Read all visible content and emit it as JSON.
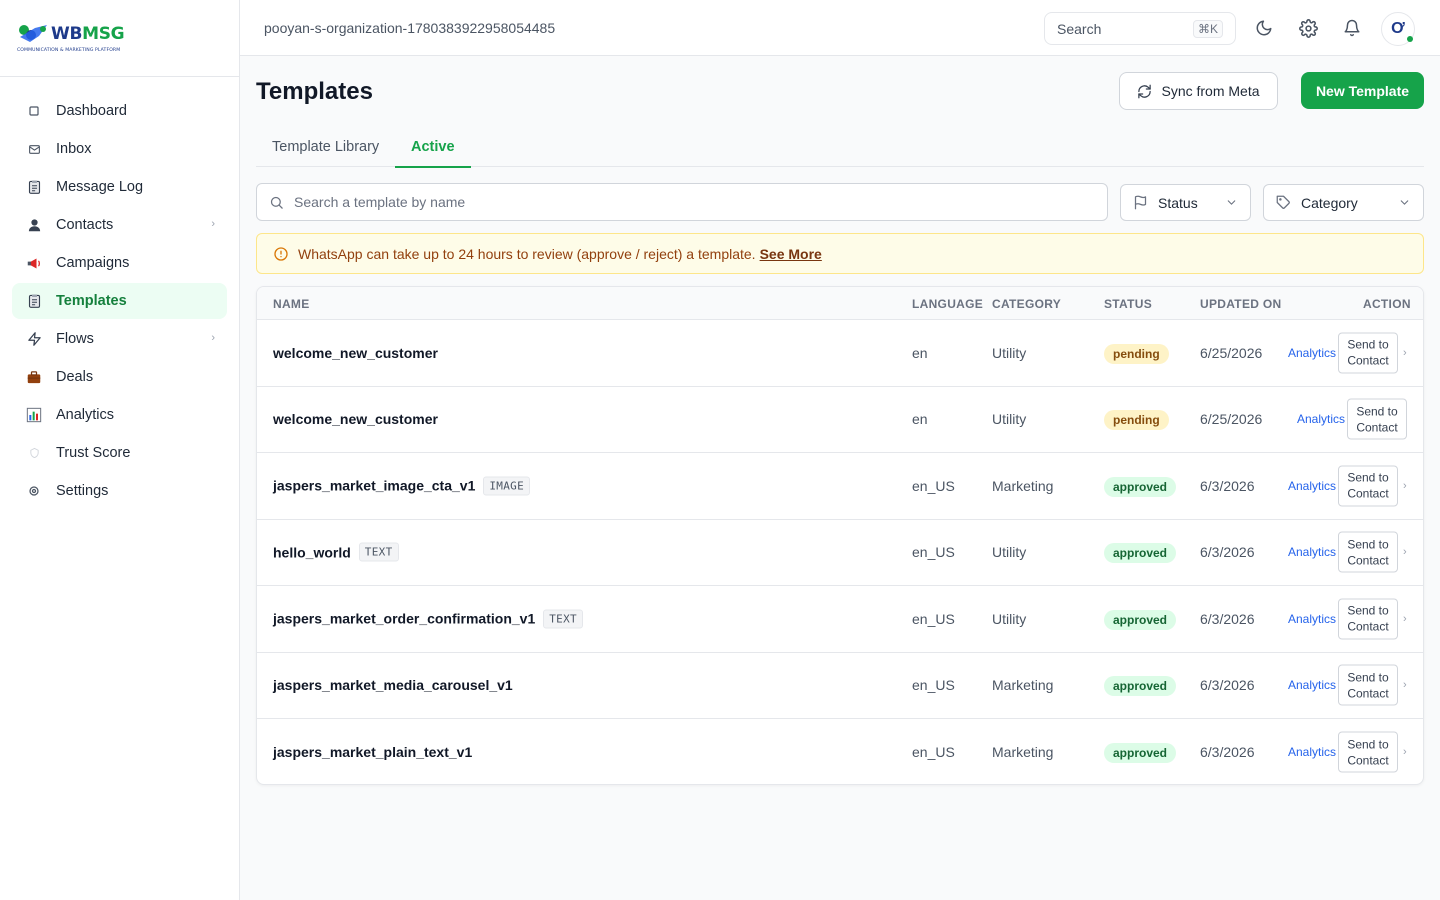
{
  "brand": {
    "name_part1": "WB",
    "name_part2": "MSG",
    "tagline": "COMMUNICATION & MARKETING PLATFORM",
    "primary_color": "#16a34a",
    "secondary_color": "#1e3a8a"
  },
  "sidebar": {
    "items": [
      {
        "label": "Dashboard",
        "icon": "square-icon",
        "active": false,
        "chevron": false
      },
      {
        "label": "Inbox",
        "icon": "envelope-icon",
        "active": false,
        "chevron": false
      },
      {
        "label": "Message Log",
        "icon": "clipboard-icon",
        "active": false,
        "chevron": false
      },
      {
        "label": "Contacts",
        "icon": "person-icon",
        "active": false,
        "chevron": true
      },
      {
        "label": "Campaigns",
        "icon": "megaphone-icon",
        "active": false,
        "chevron": false
      },
      {
        "label": "Templates",
        "icon": "clipboard-icon",
        "active": true,
        "chevron": false
      },
      {
        "label": "Flows",
        "icon": "lightning-icon",
        "active": false,
        "chevron": true
      },
      {
        "label": "Deals",
        "icon": "briefcase-icon",
        "active": false,
        "chevron": false
      },
      {
        "label": "Analytics",
        "icon": "bar-chart-icon",
        "active": false,
        "chevron": false
      },
      {
        "label": "Trust Score",
        "icon": "shield-icon",
        "active": false,
        "chevron": false
      },
      {
        "label": "Settings",
        "icon": "gear-icon",
        "active": false,
        "chevron": false
      }
    ]
  },
  "header": {
    "organization": "pooyan-s-organization-1780383922958054485",
    "search_placeholder": "Search",
    "search_shortcut": "⌘K",
    "avatar_initial": "Ơ"
  },
  "page": {
    "title": "Templates",
    "sync_button": "Sync from Meta",
    "new_button": "New Template",
    "tabs": [
      {
        "label": "Template Library",
        "active": false
      },
      {
        "label": "Active",
        "active": true
      }
    ],
    "search_placeholder": "Search a template by name",
    "status_filter": "Status",
    "category_filter": "Category",
    "notice": {
      "text": "WhatsApp can take up to 24 hours to review (approve / reject) a template.",
      "link": "See More"
    }
  },
  "table": {
    "columns": [
      "NAME",
      "LANGUAGE",
      "CATEGORY",
      "STATUS",
      "UPDATED ON",
      "ACTION"
    ],
    "analytics_label": "Analytics",
    "send_line1": "Send to",
    "send_line2": "Contact",
    "rows": [
      {
        "name": "welcome_new_customer",
        "tag": "",
        "language": "en",
        "category": "Utility",
        "status": "pending",
        "updated": "6/25/2026",
        "chevron": true
      },
      {
        "name": "welcome_new_customer",
        "tag": "",
        "language": "en",
        "category": "Utility",
        "status": "pending",
        "updated": "6/25/2026",
        "chevron": false
      },
      {
        "name": "jaspers_market_image_cta_v1",
        "tag": "IMAGE",
        "language": "en_US",
        "category": "Marketing",
        "status": "approved",
        "updated": "6/3/2026",
        "chevron": true
      },
      {
        "name": "hello_world",
        "tag": "TEXT",
        "language": "en_US",
        "category": "Utility",
        "status": "approved",
        "updated": "6/3/2026",
        "chevron": true
      },
      {
        "name": "jaspers_market_order_confirmation_v1",
        "tag": "TEXT",
        "language": "en_US",
        "category": "Utility",
        "status": "approved",
        "updated": "6/3/2026",
        "chevron": true
      },
      {
        "name": "jaspers_market_media_carousel_v1",
        "tag": "",
        "language": "en_US",
        "category": "Marketing",
        "status": "approved",
        "updated": "6/3/2026",
        "chevron": true
      },
      {
        "name": "jaspers_market_plain_text_v1",
        "tag": "",
        "language": "en_US",
        "category": "Marketing",
        "status": "approved",
        "updated": "6/3/2026",
        "chevron": true
      }
    ]
  }
}
